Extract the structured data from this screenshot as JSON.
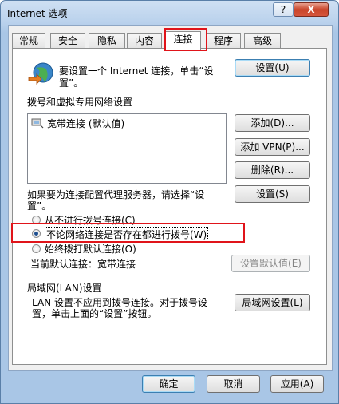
{
  "window": {
    "title": "Internet 选项",
    "help_label": "?",
    "close_label": "X"
  },
  "tabs": [
    "常规",
    "安全",
    "隐私",
    "内容",
    "连接",
    "程序",
    "高级"
  ],
  "setup": {
    "text_line1": "要设置一个 Internet 连接，单击“设",
    "text_line2": "置”。",
    "button": "设置(U)"
  },
  "dialup": {
    "heading": "拨号和虚拟专用网络设置",
    "connections": [
      {
        "label": "宽带连接 (默认值)"
      }
    ],
    "add_button": "添加(D)...",
    "add_vpn_button": "添加 VPN(P)...",
    "delete_button": "删除(R)...",
    "proxy_text_line1": "如果要为连接配置代理服务器，请选择“设",
    "proxy_text_line2": "置”。",
    "settings_button": "设置(S)",
    "options": [
      {
        "label": "从不进行拨号连接(C)",
        "checked": false
      },
      {
        "label": "不论网络连接是否存在都进行拨号(W)",
        "checked": true
      },
      {
        "label": "始终拨打默认连接(O)",
        "checked": false
      }
    ],
    "current_default": "当前默认连接：宽带连接",
    "set_default_button": "设置默认值(E)"
  },
  "lan": {
    "heading": "局域网(LAN)设置",
    "text_line1": "LAN 设置不应用到拨号连接。对于拨号设",
    "text_line2": "置，单击上面的“设置”按钮。",
    "button": "局域网设置(L)"
  },
  "footer": {
    "ok": "确定",
    "cancel": "取消",
    "apply": "应用(A)"
  }
}
